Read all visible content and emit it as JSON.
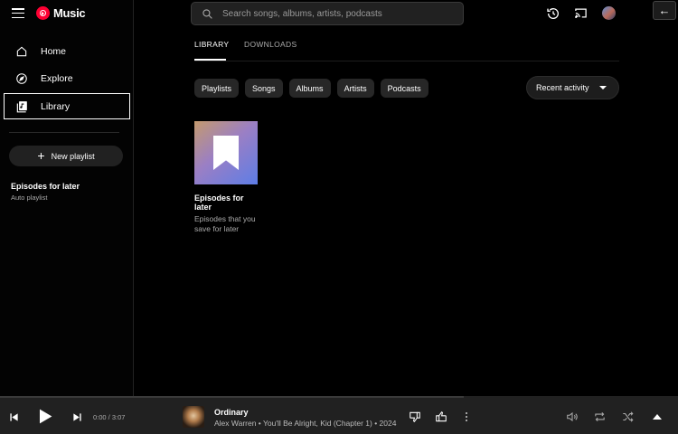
{
  "app": {
    "name": "Music"
  },
  "sidebar": {
    "items": [
      {
        "label": "Home",
        "icon": "home-icon"
      },
      {
        "label": "Explore",
        "icon": "compass-icon"
      },
      {
        "label": "Library",
        "icon": "library-icon",
        "active": true
      }
    ],
    "new_playlist_label": "New playlist",
    "playlist": {
      "title": "Episodes for later",
      "subtitle": "Auto playlist"
    }
  },
  "search": {
    "placeholder": "Search songs, albums, artists, podcasts"
  },
  "tabs": [
    {
      "label": "LIBRARY",
      "active": true
    },
    {
      "label": "DOWNLOADS",
      "active": false
    }
  ],
  "chips": [
    "Playlists",
    "Songs",
    "Albums",
    "Artists",
    "Podcasts"
  ],
  "sort": {
    "label": "Recent activity"
  },
  "card": {
    "title": "Episodes for later",
    "subtitle_line1": "Episodes that you",
    "subtitle_line2": "save for later"
  },
  "player": {
    "time": "0:00 / 3:07",
    "title": "Ordinary",
    "meta": "Alex Warren • You'll Be Alright, Kid (Chapter 1) • 2024",
    "progress": 0
  },
  "colors": {
    "accent": "#ff0033",
    "background": "#000000",
    "player_bar": "#212121"
  }
}
